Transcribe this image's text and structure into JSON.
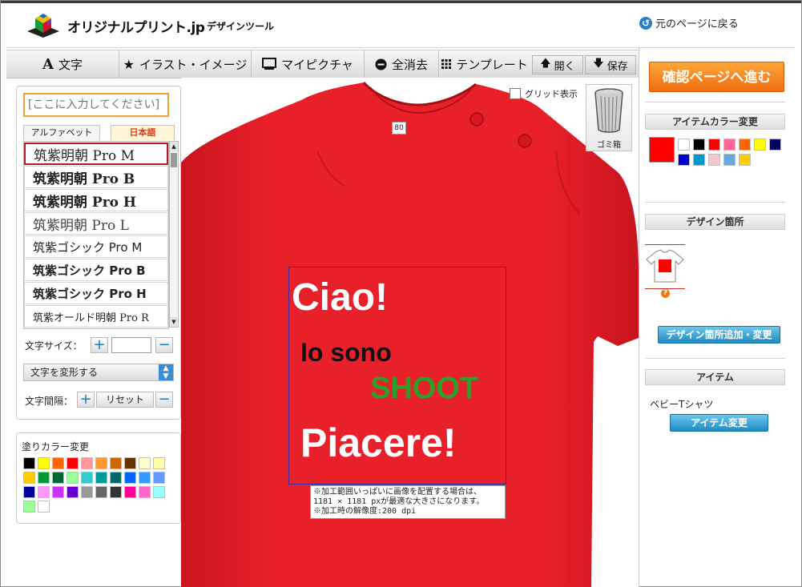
{
  "header": {
    "brand": "オリジナルプリント.jp",
    "subtitle": "デザインツール",
    "back_label": "元のページに戻る"
  },
  "toolbar": {
    "text": "文字",
    "illust": "イラスト・イメージ",
    "mypicture": "マイピクチャ",
    "clear_all": "全消去",
    "template": "テンプレート",
    "open": "開く",
    "save": "保存"
  },
  "left_panel": {
    "text_placeholder": "[ここに入力してください]",
    "tabs": [
      "アルファベット",
      "日本語"
    ],
    "fonts": [
      "筑紫明朝 Pro M",
      "筑紫明朝 Pro B",
      "筑紫明朝 Pro H",
      "筑紫明朝 Pro L",
      "筑紫ゴシック Pro M",
      "筑紫ゴシック Pro B",
      "筑紫ゴシック Pro H",
      "筑紫オールド明朝 Pro R"
    ],
    "font_size_label": "文字サイズ：",
    "transform_label": "文字を変形する",
    "spacing_label": "文字間隔：",
    "reset_label": "リセット",
    "fill_color_label": "塗りカラー変更",
    "fill_colors": [
      "#000000",
      "#ffff00",
      "#ff6600",
      "#ff0000",
      "#ff9999",
      "#ff9933",
      "#cc6600",
      "#663300",
      "#ffffcc",
      "#ffffaa",
      "#ffcc00",
      "#009933",
      "#006633",
      "#99ff99",
      "#33cccc",
      "#009999",
      "#006666",
      "#0066ff",
      "#3399ff",
      "#6699ff",
      "#000099",
      "#ff99ff",
      "#cc33ff",
      "#6600cc",
      "#999999",
      "#666666",
      "#333333",
      "#ff0099",
      "#ff66cc",
      "#99ffff",
      "#99ff99",
      "#ffffff"
    ]
  },
  "canvas": {
    "grid_label": "グリッド表示",
    "size_tag": "80",
    "trash_label": "ゴミ箱",
    "design_texts": {
      "line1": "Ciao!",
      "line2": "Io sono",
      "line3": "SHOOT",
      "line4": "Piacere!"
    },
    "note_lines": [
      "※加工範囲いっぱいに画像を配置する場合は、",
      "  1181 × 1181 pxが最適な大きさになります。",
      "※加工時の解像度:200 dpi"
    ],
    "shirt_color": "#e8202a"
  },
  "right_panel": {
    "confirm_label": "確認ページへ進む",
    "item_color_header": "アイテムカラー変更",
    "selected_color": "#ff0000",
    "item_colors": [
      "#ffffff",
      "#000000",
      "#ff0000",
      "#ff6699",
      "#ff6600",
      "#ffff00",
      "#000066",
      "#0000cc",
      "#0099cc",
      "#f4c8c8",
      "#66aadd",
      "#ffcc00"
    ],
    "design_area_header": "デザイン箇所",
    "design_area_button": "デザイン箇所追加・変更",
    "item_header": "アイテム",
    "item_name": "ベビーTシャツ",
    "item_change_button": "アイテム変更"
  }
}
